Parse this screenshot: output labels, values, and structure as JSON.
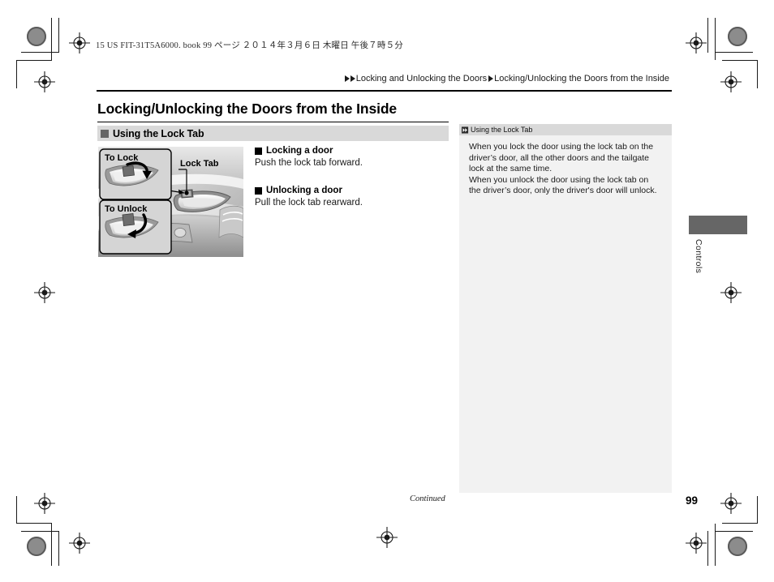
{
  "document": {
    "file_header": "15 US FIT-31T5A6000. book   99 ページ   ２０１４年３月６日   木曜日   午後７時５分",
    "page_number": "99",
    "continued_label": "Continued",
    "thumb_tab_label": "Controls"
  },
  "breadcrumb": {
    "arrow_icon": "triangle-right-icon",
    "level1": "Locking and Unlocking the Doors",
    "level2": "Locking/Unlocking the Doors from the Inside"
  },
  "main": {
    "title": "Locking/Unlocking the Doors from the Inside",
    "section": {
      "bullet_icon": "filled-square-icon",
      "heading": "Using the Lock Tab"
    },
    "illustration": {
      "name": "door-lock-tab-illustration",
      "callout_lock": "To Lock",
      "callout_unlock": "To Unlock",
      "callout_lock_tab": "Lock Tab"
    },
    "items": [
      {
        "bullet_icon": "filled-square-icon",
        "heading": "Locking a door",
        "text": "Push the lock tab forward."
      },
      {
        "bullet_icon": "filled-square-icon",
        "heading": "Unlocking a door",
        "text": "Pull the lock tab rearward."
      }
    ]
  },
  "note_panel": {
    "marker_icon": "double-chevron-right-icon",
    "heading": "Using the Lock Tab",
    "paragraphs": [
      "When you lock the door using the lock tab on the driver’s door, all the other doors and the tailgate lock at the same time.",
      "When you unlock the door using the lock tab on the driver’s door, only the driver's door will unlock."
    ]
  },
  "colors": {
    "section_bar": "#d9d9d9",
    "note_panel_bg": "#f2f2f2",
    "note_head_bg": "#d9d9d9",
    "thumb_tab": "#666666",
    "text": "#1a1a1a"
  }
}
